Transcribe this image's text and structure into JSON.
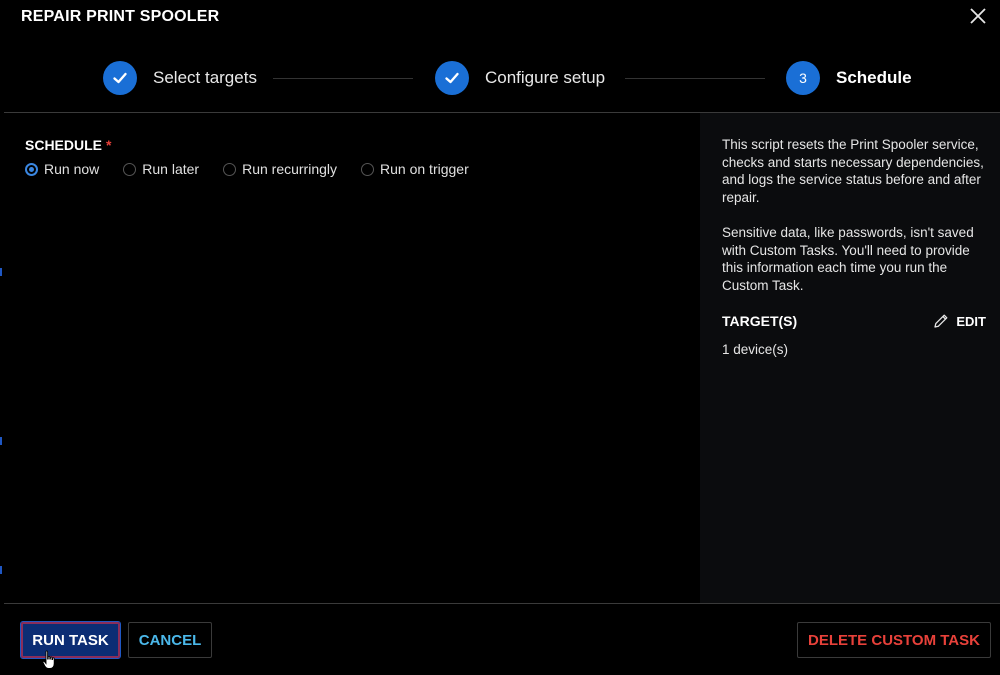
{
  "dialog": {
    "title": "REPAIR PRINT SPOOLER"
  },
  "stepper": {
    "steps": [
      {
        "label": "Select targets",
        "state": "complete",
        "icon": "check-icon"
      },
      {
        "label": "Configure setup",
        "state": "complete",
        "icon": "check-icon"
      },
      {
        "label": "Schedule",
        "number": "3",
        "state": "active"
      }
    ]
  },
  "schedule": {
    "label": "SCHEDULE",
    "required_mark": "*",
    "options": [
      {
        "label": "Run now",
        "checked": true
      },
      {
        "label": "Run later",
        "checked": false
      },
      {
        "label": "Run recurringly",
        "checked": false
      },
      {
        "label": "Run on trigger",
        "checked": false
      }
    ]
  },
  "info": {
    "description": "This script resets the Print Spooler service, checks and starts necessary dependencies, and logs the service status before and after repair.",
    "sensitive_note": "Sensitive data, like passwords, isn't saved with Custom Tasks. You'll need to provide this information each time you run the Custom Task.",
    "targets_title": "TARGET(S)",
    "edit_label": "EDIT",
    "targets_value": "1 device(s)"
  },
  "footer": {
    "run_label": "RUN TASK",
    "cancel_label": "CANCEL",
    "delete_label": "DELETE CUSTOM TASK"
  },
  "colors": {
    "accent": "#1a6fd6",
    "link": "#4bb8ea",
    "danger": "#e8413a",
    "primary_button": "#0c2d74"
  }
}
